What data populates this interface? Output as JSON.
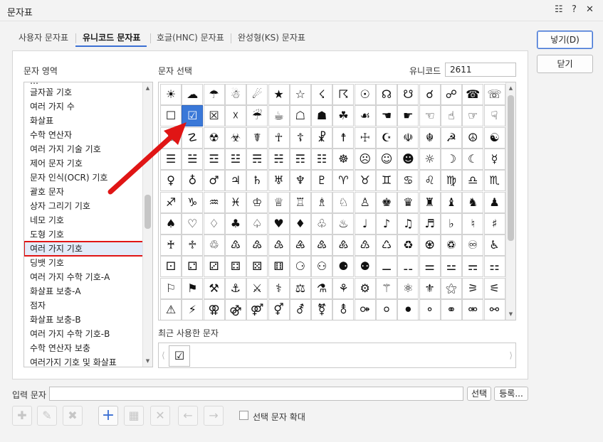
{
  "window": {
    "title": "문자표",
    "help_label": "?"
  },
  "tabs": [
    {
      "label": "사용자 문자표"
    },
    {
      "label": "유니코드 문자표"
    },
    {
      "label": "호글(HNC) 문자표"
    },
    {
      "label": "완성형(KS) 문자표"
    }
  ],
  "active_tab": "유니코드 문자표",
  "area": {
    "label": "문자 영역",
    "items": [
      "글자꼴 기호",
      "여러 가지 수",
      "화살표",
      "수학 연산자",
      "여러 가지 기술 기호",
      "제어 문자 기호",
      "문자 인식(OCR) 기호",
      "괄호 문자",
      "상자 그리기 기호",
      "네모 기호",
      "도형 기호",
      "여러 가지 기호",
      "딩뱃 기호",
      "여러 가지 수학 기호-A",
      "화살표 보충-A",
      "점자",
      "화살표 보충-B",
      "여러 가지 수학 기호-B",
      "수학 연산자 보충",
      "여러가지 기호 및 화살표"
    ],
    "selected": "여러 가지 기호"
  },
  "char_select": {
    "label": "문자 선택",
    "unicode_label": "유니코드",
    "unicode_value": "2611",
    "rows": [
      [
        "☀",
        "☁",
        "☂",
        "☃",
        "☄",
        "★",
        "☆",
        "☇",
        "☈",
        "☉",
        "☊",
        "☋",
        "☌",
        "☍",
        "☎",
        "☏"
      ],
      [
        "☐",
        "☑",
        "☒",
        "☓",
        "☔",
        "☕",
        "☖",
        "☗",
        "☘",
        "☙",
        "☚",
        "☛",
        "☜",
        "☝",
        "☞",
        "☟"
      ],
      [
        "☠",
        "☡",
        "☢",
        "☣",
        "☤",
        "☥",
        "☦",
        "☧",
        "☨",
        "☩",
        "☪",
        "☫",
        "☬",
        "☭",
        "☮",
        "☯"
      ],
      [
        "☰",
        "☱",
        "☲",
        "☳",
        "☴",
        "☵",
        "☶",
        "☷",
        "☸",
        "☹",
        "☺",
        "☻",
        "☼",
        "☽",
        "☾",
        "☿"
      ],
      [
        "♀",
        "♁",
        "♂",
        "♃",
        "♄",
        "♅",
        "♆",
        "♇",
        "♈",
        "♉",
        "♊",
        "♋",
        "♌",
        "♍",
        "♎",
        "♏"
      ],
      [
        "♐",
        "♑",
        "♒",
        "♓",
        "♔",
        "♕",
        "♖",
        "♗",
        "♘",
        "♙",
        "♚",
        "♛",
        "♜",
        "♝",
        "♞",
        "♟"
      ],
      [
        "♠",
        "♡",
        "♢",
        "♣",
        "♤",
        "♥",
        "♦",
        "♧",
        "♨",
        "♩",
        "♪",
        "♫",
        "♬",
        "♭",
        "♮",
        "♯"
      ],
      [
        "♰",
        "♱",
        "♲",
        "♳",
        "♴",
        "♵",
        "♶",
        "♷",
        "♸",
        "♹",
        "♺",
        "♻",
        "♼",
        "♽",
        "♾",
        "♿"
      ],
      [
        "⚀",
        "⚁",
        "⚂",
        "⚃",
        "⚄",
        "⚅",
        "⚆",
        "⚇",
        "⚈",
        "⚉",
        "⚊",
        "⚋",
        "⚌",
        "⚍",
        "⚎",
        "⚏"
      ],
      [
        "⚐",
        "⚑",
        "⚒",
        "⚓",
        "⚔",
        "⚕",
        "⚖",
        "⚗",
        "⚘",
        "⚙",
        "⚚",
        "⚛",
        "⚜",
        "⚝",
        "⚞",
        "⚟"
      ],
      [
        "⚠",
        "⚡",
        "⚢",
        "⚣",
        "⚤",
        "⚥",
        "⚦",
        "⚧",
        "⚨",
        "⚩",
        "⚪",
        "⚫",
        "⚬",
        "⚭",
        "⚮",
        "⚯"
      ]
    ],
    "selected_char": "☑"
  },
  "recent": {
    "label": "최근 사용한 문자",
    "chars": [
      "☑"
    ]
  },
  "buttons": {
    "insert": "넣기(D)",
    "close": "닫기",
    "select": "선택",
    "register": "등록..."
  },
  "input": {
    "label": "입력 문자",
    "value": ""
  },
  "zoom_checkbox": {
    "label": "선택 문자 확대",
    "checked": false
  },
  "annotation": {
    "color": "#e01515"
  },
  "colors": {
    "accent": "#3b6fd3",
    "selection": "#3a78d8",
    "highlight": "#e01515"
  }
}
